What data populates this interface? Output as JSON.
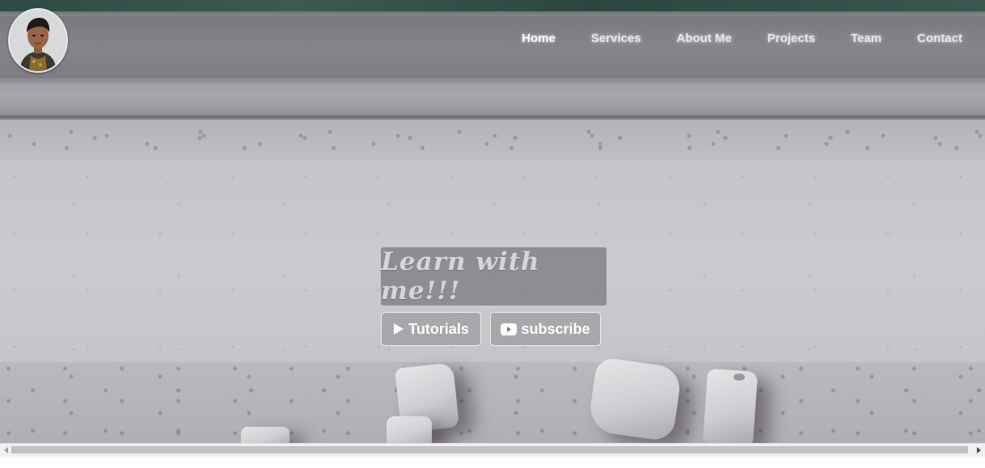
{
  "nav": {
    "items": [
      {
        "label": "Home",
        "active": true
      },
      {
        "label": "Services",
        "active": false
      },
      {
        "label": "About Me",
        "active": false
      },
      {
        "label": "Projects",
        "active": false
      },
      {
        "label": "Team",
        "active": false
      },
      {
        "label": "Contact",
        "active": false
      }
    ]
  },
  "hero": {
    "title": "Learn with me!!!",
    "buttons": [
      {
        "label": "Tutorials",
        "icon": "play-icon"
      },
      {
        "label": "subscribe",
        "icon": "youtube-icon"
      }
    ]
  },
  "colors": {
    "nav_text": "#e2e6ee",
    "button_border": "#ecebe6",
    "title_box": "#78767c",
    "title_text": "#d6d5da"
  }
}
